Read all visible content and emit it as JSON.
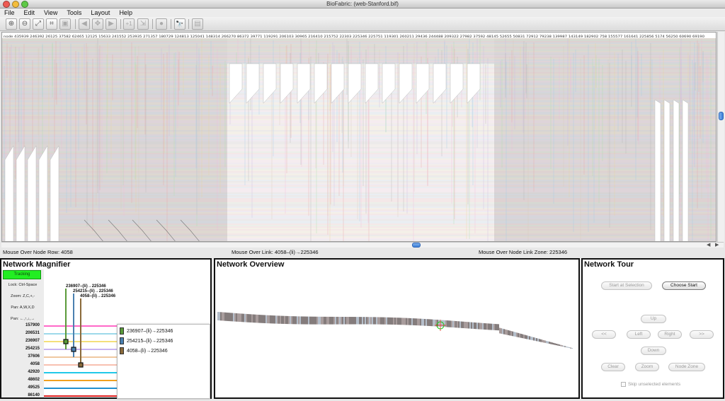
{
  "window": {
    "title": "BioFabric: (web-Stanford.bif)"
  },
  "menu": [
    "File",
    "Edit",
    "View",
    "Tools",
    "Layout",
    "Help"
  ],
  "toolbar": {
    "buttons": [
      {
        "name": "zoom-in-icon",
        "glyph": "⊕"
      },
      {
        "name": "zoom-out-icon",
        "glyph": "⊖"
      },
      {
        "name": "zoom-to-model-icon",
        "glyph": "⤢"
      },
      {
        "name": "zoom-to-rect-icon",
        "glyph": "⌗"
      },
      {
        "name": "zoom-to-selection-icon",
        "glyph": "▣"
      },
      {
        "name": "back-icon",
        "glyph": "◀"
      },
      {
        "name": "center-icon",
        "glyph": "✥"
      },
      {
        "name": "forward-icon",
        "glyph": "▶"
      },
      {
        "name": "add-first-neighbors-icon",
        "glyph": "+1"
      },
      {
        "name": "propagate-selection-icon",
        "glyph": "⇲"
      },
      {
        "name": "clear-selection-icon",
        "glyph": "●"
      },
      {
        "name": "search-binoculars-icon",
        "glyph": "🔭"
      },
      {
        "name": "network-view-icon",
        "glyph": "▤"
      }
    ]
  },
  "fabric": {
    "node_labels": "node 435939 246392 26125 37582 62465 12125 15633 241552 253935 271357 180729 124813 125041 148314 266270 86372 39771 119291 206103 30965 216410 215752 22303 225346 225751 119301 260211 29436 244488 209322 27982 37592 48145 52655 50831 72912 79238 139987 143149 182902 758 155577 161641 225856 5174 56250 60690 69190"
  },
  "status": {
    "node_row": "Mouse Over Node Row: 4058",
    "link": "Mouse Over Link: 4058–(li)→225346",
    "link_zone": "Mouse Over Node Link Zone: 225346"
  },
  "magnifier": {
    "title": "Network Magnifier",
    "tracking": "Tracking",
    "hints": [
      "Lock: Ctrl-Space",
      "Zoom: Z,C,+,-",
      "Pan: A,W,X,D",
      "Pan: ←,↑,↓,→"
    ],
    "rows": [
      {
        "label": "157900",
        "color": "#ff69c8"
      },
      {
        "label": "206531",
        "color": "#9dd9ea"
      },
      {
        "label": "236907",
        "color": "#f4e07a"
      },
      {
        "label": "254215",
        "color": "#c8b4f0"
      },
      {
        "label": "37606",
        "color": "#f0c8a0"
      },
      {
        "label": "4058",
        "color": "#f8c0b0"
      },
      {
        "label": "42920",
        "color": "#22c8e8"
      },
      {
        "label": "48602",
        "color": "#f0a020"
      },
      {
        "label": "49525",
        "color": "#2090d0"
      },
      {
        "label": "86140",
        "color": "#e02020"
      }
    ],
    "links": [
      {
        "label": "236907–(li)→225346",
        "color": "#5a9a3a"
      },
      {
        "label": "254215–(li)→225346",
        "color": "#4a80b0"
      },
      {
        "label": "4058–(li)→225346",
        "color": "#8a6a3a"
      }
    ]
  },
  "overview": {
    "title": "Network Overview"
  },
  "tour": {
    "title": "Network Tour",
    "start_at_selection": "Start at Selection",
    "choose_start": "Choose Start",
    "up": "Up",
    "first": "<<",
    "left": "Left",
    "right": "Right",
    "last": ">>",
    "down": "Down",
    "clear": "Clear",
    "zoom": "Zoom",
    "node_zone": "Node Zone",
    "skip_unselected": "Skip unselected elements"
  },
  "colors": {
    "tracking_green": "#22ee22",
    "scroll_blue": "#3c7fd8",
    "fabric_shade": "#e0dcdc"
  }
}
